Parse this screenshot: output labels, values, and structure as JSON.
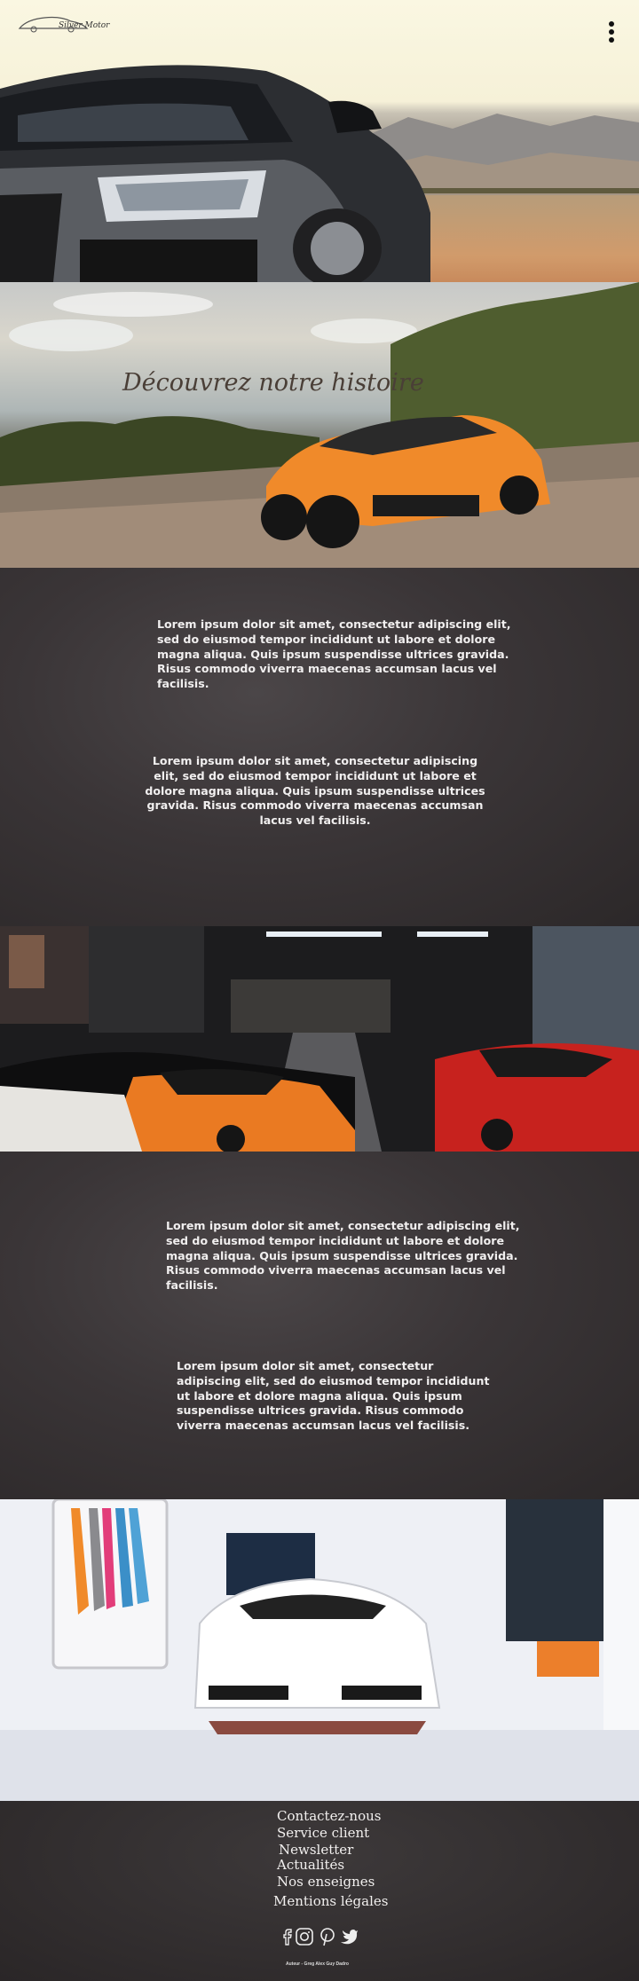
{
  "header": {
    "logo_text": "Silver Motor"
  },
  "story": {
    "title": "Découvrez notre histoire"
  },
  "content": {
    "paragraph_1": "Lorem ipsum dolor sit amet, consectetur adipiscing elit, sed do eiusmod tempor incididunt ut labore et dolore magna aliqua. Quis ipsum suspendisse ultrices gravida. Risus commodo viverra maecenas accumsan lacus vel facilisis.",
    "paragraph_2": "Lorem ipsum dolor sit amet, consectetur adipiscing elit, sed do eiusmod tempor incididunt ut labore et dolore magna aliqua. Quis ipsum suspendisse ultrices gravida. Risus commodo viverra maecenas accumsan lacus vel facilisis.",
    "paragraph_3": "Lorem ipsum dolor sit amet, consectetur adipiscing elit, sed do eiusmod tempor incididunt ut labore et dolore magna aliqua. Quis ipsum suspendisse ultrices gravida. Risus commodo viverra maecenas accumsan lacus vel facilisis.",
    "paragraph_4": "Lorem ipsum dolor sit amet, consectetur adipiscing elit, sed do eiusmod tempor incididunt ut labore et dolore magna aliqua. Quis ipsum suspendisse ultrices gravida. Risus commodo viverra maecenas accumsan lacus vel facilisis."
  },
  "footer": {
    "links": {
      "contact": "Contactez-nous",
      "service": "Service client",
      "newsletter": "Newsletter",
      "news": "Actualités",
      "brands": "Nos enseignes",
      "legal": "Mentions légales"
    },
    "social_icons": [
      "facebook-icon",
      "instagram-icon",
      "pinterest-icon",
      "twitter-icon"
    ],
    "author": "Auteur - Greg Alex Guy Dadro"
  },
  "colors": {
    "dark_panel": "#3a3537",
    "hero_sky": "#faf7e2",
    "lamborghini_orange": "#f08a2a",
    "text_light": "#f1efef"
  }
}
